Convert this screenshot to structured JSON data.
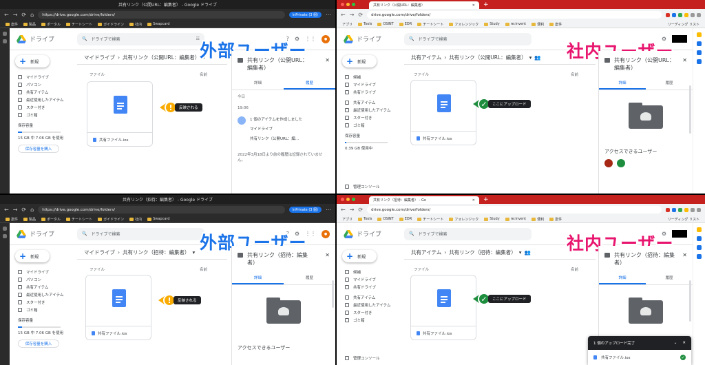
{
  "app": {
    "name": "ドライブ",
    "search_placeholder": "ドライブで検索",
    "new_label": "新規"
  },
  "sidebar_external": [
    "マイドライブ",
    "パソコン",
    "共有アイテム",
    "最近使用したアイテム",
    "スター付き",
    "ゴミ箱"
  ],
  "sidebar_internal": [
    "候補",
    "マイドライブ",
    "共有ドライブ",
    "共有アイテム",
    "最近使用したアイテム",
    "スター付き",
    "ゴミ箱"
  ],
  "storage": {
    "label": "保存容量",
    "ext_used": "15 GB 中 7.06 GB を使用",
    "int_used": "0.39 GB 使用中",
    "buy": "保存容量を購入",
    "admin": "管理コンソール"
  },
  "files_label": "ファイル",
  "name_col": "名前",
  "file_name": "共有ファイル.ios",
  "labels": {
    "external": "外部ユーザー",
    "internal": "社内ユーザー",
    "reflected": "反映される",
    "upload_here": "ここにアップロード"
  },
  "q1": {
    "window_title": "共有リンク（公開URL：編集者） - Google ドライブ",
    "url": "https://drive.google.com/drive/folders/",
    "inprivate": "InPrivate (3 個)",
    "bookmarks": [
      "案件",
      "製品",
      "ポータル",
      "チートシート",
      "ガイドライン",
      "社内",
      "Swapcard"
    ],
    "crumb_root": "マイドライブ",
    "crumb_folder": "共有リンク（公開URL：編集者）",
    "panel_title": "共有リンク（公開URL：編集者）",
    "tab_details": "詳細",
    "tab_activity": "履歴",
    "activity_today": "今日",
    "activity_time": "19:06",
    "activity_text": "1 個のアイテムを作成しました",
    "activity_path1": "マイドライブ",
    "activity_path2": "共有リンク（公開URL：編...",
    "activity_note": "2022年3月18日より前の履歴は記録されていません。"
  },
  "q2": {
    "tab_title": "共有リンク（公開URL：編集者）",
    "url": "drive.google.com/drive/folders/",
    "bookmarks": [
      "アプリ",
      "Tools",
      "OSINT",
      "EDR",
      "チートシート",
      "フォレンジック",
      "Study",
      "re:invent",
      "便利",
      "案件"
    ],
    "reading_list": "リーディング リスト",
    "crumb_root": "共有アイテム",
    "crumb_folder": "共有リンク（公開URL：編集者）",
    "panel_title": "共有リンク（公開URL：編集者）",
    "tab_details": "詳細",
    "tab_activity": "履歴",
    "access_label": "アクセスできるユーザー"
  },
  "q3": {
    "window_title": "共有リンク（招待：編集者） - Google ドライブ",
    "url": "https://drive.google.com/drive/folders/",
    "inprivate": "InPrivate (3 個)",
    "bookmarks": [
      "案件",
      "製品",
      "ポータル",
      "チートシート",
      "ガイドライン",
      "社内",
      "Swapcard"
    ],
    "crumb_root": "マイドライブ",
    "crumb_folder": "共有リンク（招待：編集者）",
    "panel_title": "共有リンク（招待：編集者）",
    "tab_details": "詳細",
    "tab_activity": "履歴",
    "access_label": "アクセスできるユーザー"
  },
  "q4": {
    "tab_title": "共有リンク（招待：編集者） - Go",
    "url": "drive.google.com/drive/folders/",
    "bookmarks": [
      "アプリ",
      "Tools",
      "OSINT",
      "EDR",
      "チートシート",
      "フォレンジック",
      "Study",
      "re:invent",
      "便利",
      "案件"
    ],
    "reading_list": "リーディング リスト",
    "crumb_root": "共有アイテム",
    "crumb_folder": "共有リンク（招待：編集者）",
    "panel_title": "共有リンク（招待：編集者）",
    "tab_details": "詳細",
    "tab_activity": "履歴",
    "upload_done": "1 個のアップロード完了"
  },
  "colors": {
    "brand_blue": "#1a73e8",
    "pink": "#e8156f",
    "warn": "#f9ab00",
    "ok": "#1e8e3e",
    "chrome_red": "#c5221f"
  }
}
